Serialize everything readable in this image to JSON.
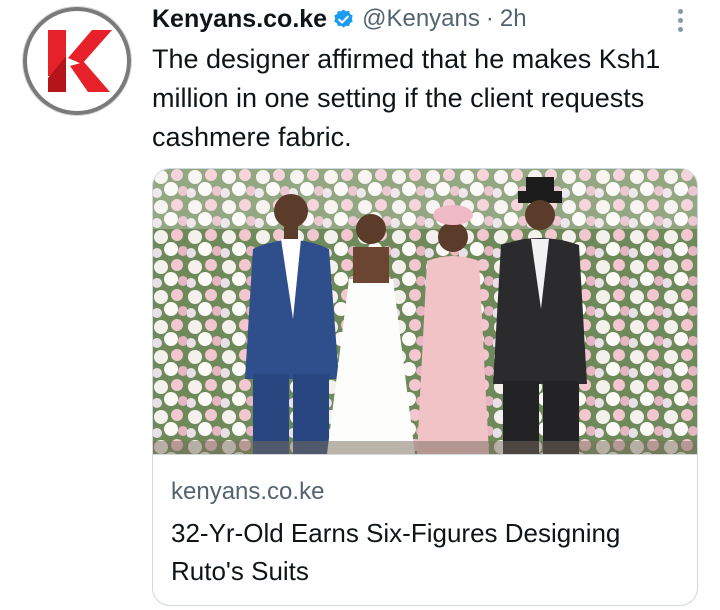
{
  "tweet": {
    "author_name": "Kenyans.co.ke",
    "handle": "@Kenyans",
    "separator": "·",
    "time": "2h",
    "text": "The designer affirmed that he makes Ksh1 million in one setting if the client requests cashmere fabric.",
    "avatar_letter": "K",
    "verified_icon": "verified-badge-icon",
    "more_icon": "vertical-dots-icon"
  },
  "card": {
    "domain": "kenyans.co.ke",
    "title": "32-Yr-Old Earns Six-Figures Designing Ruto's Suits"
  },
  "colors": {
    "brand_red": "#e62129",
    "verified_blue": "#1d9bf0",
    "secondary_text": "#536471",
    "primary_text": "#0f1419",
    "border": "#cfd9de"
  }
}
